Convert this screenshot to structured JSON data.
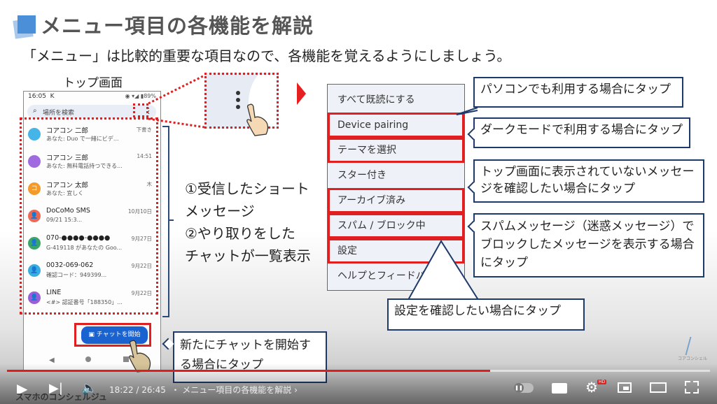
{
  "slide": {
    "title": "メニュー項目の各機能を解説",
    "subtitle": "「メニュー」は比較的重要な項目なので、各機能を覚えるようにしましょう。",
    "phone_label": "トップ画面",
    "description_lines": [
      "①受信したショート",
      "メッセージ",
      "②やり取りをした",
      "チャットが一覧表示"
    ]
  },
  "phone": {
    "status_time": "16:05",
    "status_extra": "K",
    "status_right": "◉ ▾◢ ▮89%",
    "search_placeholder": "場所を検索",
    "conversations": [
      {
        "name": "コアコン 二郎",
        "snippet": "あなた: Duo で一緒にビデ...",
        "time": "下書き",
        "avatar_color": "#45b4e6",
        "avatar_glyph": ""
      },
      {
        "name": "コアコン 三郎",
        "snippet": "あなた: 無料電話持つできる...",
        "time": "14:51",
        "avatar_color": "#a06be0",
        "avatar_glyph": ""
      },
      {
        "name": "コアコン 太郎",
        "snippet": "あなた: 宜しく",
        "time": "木",
        "avatar_color": "#f39a2c",
        "avatar_glyph": "コ"
      },
      {
        "name": "DoCoMo SMS",
        "snippet": "09/21 15:3...",
        "time": "10月10日",
        "avatar_color": "#ec6a55",
        "avatar_glyph": "👤"
      },
      {
        "name": "070-●●●●-●●●●",
        "snippet": "G-419118 があなたの Goo...",
        "time": "9月27日",
        "avatar_color": "#3aa568",
        "avatar_glyph": "👤"
      },
      {
        "name": "0032-069-062",
        "snippet": "確認コード：949399...",
        "time": "9月22日",
        "avatar_color": "#38aee0",
        "avatar_glyph": "👤"
      },
      {
        "name": "LINE",
        "snippet": "<#> 認証番号「188350」...",
        "time": "9月22日",
        "avatar_color": "#9a5ed8",
        "avatar_glyph": "👤"
      }
    ],
    "start_chat_label": "チャットを開始"
  },
  "menu": {
    "items": [
      {
        "label": "すべて既読にする",
        "highlighted": false
      },
      {
        "label": "Device pairing",
        "highlighted": true
      },
      {
        "label": "テーマを選択",
        "highlighted": true
      },
      {
        "label": "スター付き",
        "highlighted": false
      },
      {
        "label": "アーカイブ済み",
        "highlighted": true
      },
      {
        "label": "スパム / ブロック中",
        "highlighted": true
      },
      {
        "label": "設定",
        "highlighted": true
      },
      {
        "label": "ヘルプとフィードバック",
        "highlighted": false
      }
    ]
  },
  "callouts": {
    "device_pairing": "パソコンでも利用する場合にタップ",
    "theme": "ダークモードで利用する場合にタップ",
    "archived": "トップ画面に表示されていないメッセージを確認したい場合にタップ",
    "spam": "スパムメッセージ（迷惑メッセージ）でブロックしたメッセージを表示する場合にタップ",
    "settings": "設定を確認したい場合にタップ",
    "start_chat": "新たにチャットを開始する場合にタップ"
  },
  "watermark": {
    "text": "コアコンシェル"
  },
  "player": {
    "current_time": "18:22",
    "duration": "26:45",
    "time_display": "18:22 / 26:45",
    "chapter": "・ メニュー項目の各機能を解説 ›",
    "progress_fraction": 0.687,
    "channel_name": "スマホのコンシェルジュ",
    "hd_badge": "HD",
    "accent_color": "#e01d1d"
  }
}
